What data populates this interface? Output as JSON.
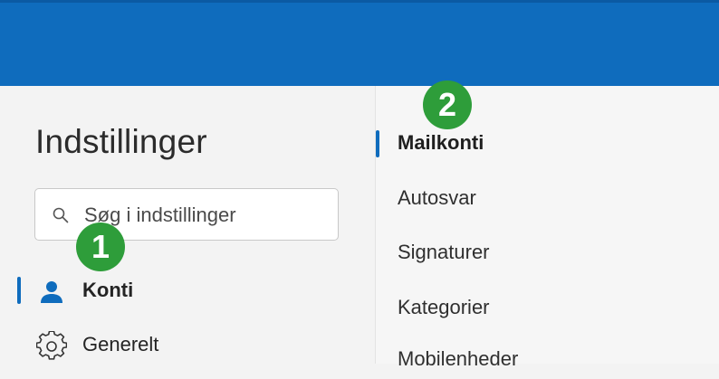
{
  "settings": {
    "title": "Indstillinger",
    "search_placeholder": "Søg i indstillinger"
  },
  "nav": [
    {
      "label": "Konti",
      "icon": "person-icon",
      "active": true
    },
    {
      "label": "Generelt",
      "icon": "gear-icon",
      "active": false
    }
  ],
  "subnav": [
    {
      "label": "Mailkonti",
      "active": true
    },
    {
      "label": "Autosvar",
      "active": false
    },
    {
      "label": "Signaturer",
      "active": false
    },
    {
      "label": "Kategorier",
      "active": false
    },
    {
      "label": "Mobilenheder",
      "active": false
    }
  ],
  "badges": [
    "1",
    "2"
  ],
  "colors": {
    "header": "#0f6cbd",
    "accent": "#0f6cbd",
    "badge": "#2e9d3a"
  }
}
